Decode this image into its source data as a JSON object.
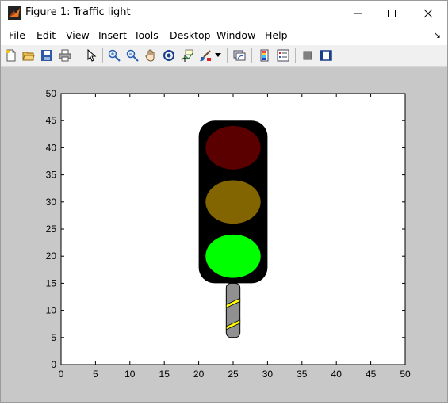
{
  "window": {
    "title": "Figure 1: Traffic light",
    "controls": [
      "minimize",
      "maximize",
      "close"
    ]
  },
  "menu": {
    "items": [
      "File",
      "Edit",
      "View",
      "Insert",
      "Tools",
      "Desktop",
      "Window",
      "Help"
    ],
    "dock_arrow": "↘"
  },
  "toolbar": {
    "icons": [
      "new-figure-icon",
      "open-file-icon",
      "save-icon",
      "print-icon",
      "pointer-arrow-icon",
      "zoom-in-icon",
      "zoom-out-icon",
      "pan-hand-icon",
      "rotate-3d-icon",
      "data-cursor-icon",
      "brush-icon",
      "brush-dropdown-icon",
      "link-plot-icon",
      "colorbar-icon",
      "legend-icon",
      "hide-plot-tools-icon",
      "show-plot-tools-icon"
    ]
  },
  "axes": {
    "xlim": [
      0,
      50
    ],
    "ylim": [
      0,
      50
    ],
    "xticks": [
      "0",
      "5",
      "10",
      "15",
      "20",
      "25",
      "30",
      "35",
      "40",
      "45",
      "50"
    ],
    "yticks": [
      "0",
      "5",
      "10",
      "15",
      "20",
      "25",
      "30",
      "35",
      "40",
      "45",
      "50"
    ],
    "background": "#ffffff"
  },
  "traffic_light": {
    "housing": {
      "x": [
        20,
        30
      ],
      "y": [
        15,
        45
      ],
      "color": "#000000"
    },
    "lamps": [
      {
        "name": "red",
        "center": [
          25,
          40
        ],
        "radii": [
          4,
          4
        ],
        "color": "#5a0000"
      },
      {
        "name": "amber",
        "center": [
          25,
          30
        ],
        "radii": [
          4,
          4
        ],
        "color": "#826400"
      },
      {
        "name": "green",
        "center": [
          25,
          20
        ],
        "radii": [
          4,
          4
        ],
        "color": "#00ff00"
      }
    ],
    "pole": {
      "x": [
        24,
        26
      ],
      "y": [
        5,
        15
      ],
      "color": "#909090",
      "stripe_color": "#ffff00"
    }
  },
  "colors": {
    "figure_bg": "#c8c8c8",
    "toolbar_bg": "#f0f0f0"
  }
}
